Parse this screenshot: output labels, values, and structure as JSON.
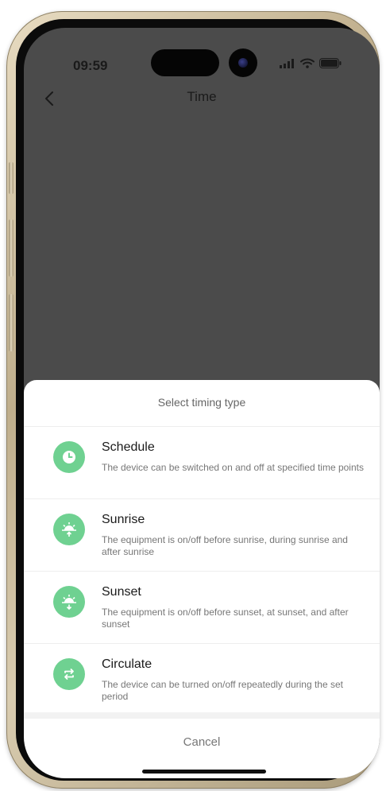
{
  "status_bar": {
    "time": "09:59"
  },
  "nav": {
    "title": "Time"
  },
  "sheet": {
    "title": "Select timing type",
    "options": [
      {
        "icon": "clock-icon",
        "title": "Schedule",
        "description": "The device can be switched on and off at specified time points"
      },
      {
        "icon": "sunrise-icon",
        "title": "Sunrise",
        "description": "The equipment is on/off before sunrise, during sunrise and after sunrise"
      },
      {
        "icon": "sunset-icon",
        "title": "Sunset",
        "description": "The equipment is on/off before sunset, at sunset, and after sunset"
      },
      {
        "icon": "circulate-icon",
        "title": "Circulate",
        "description": "The device can be turned on/off repeatedly during the set period"
      }
    ],
    "cancel_label": "Cancel"
  },
  "colors": {
    "accent": "#6fd191",
    "overlay": "#4b4b4b"
  }
}
